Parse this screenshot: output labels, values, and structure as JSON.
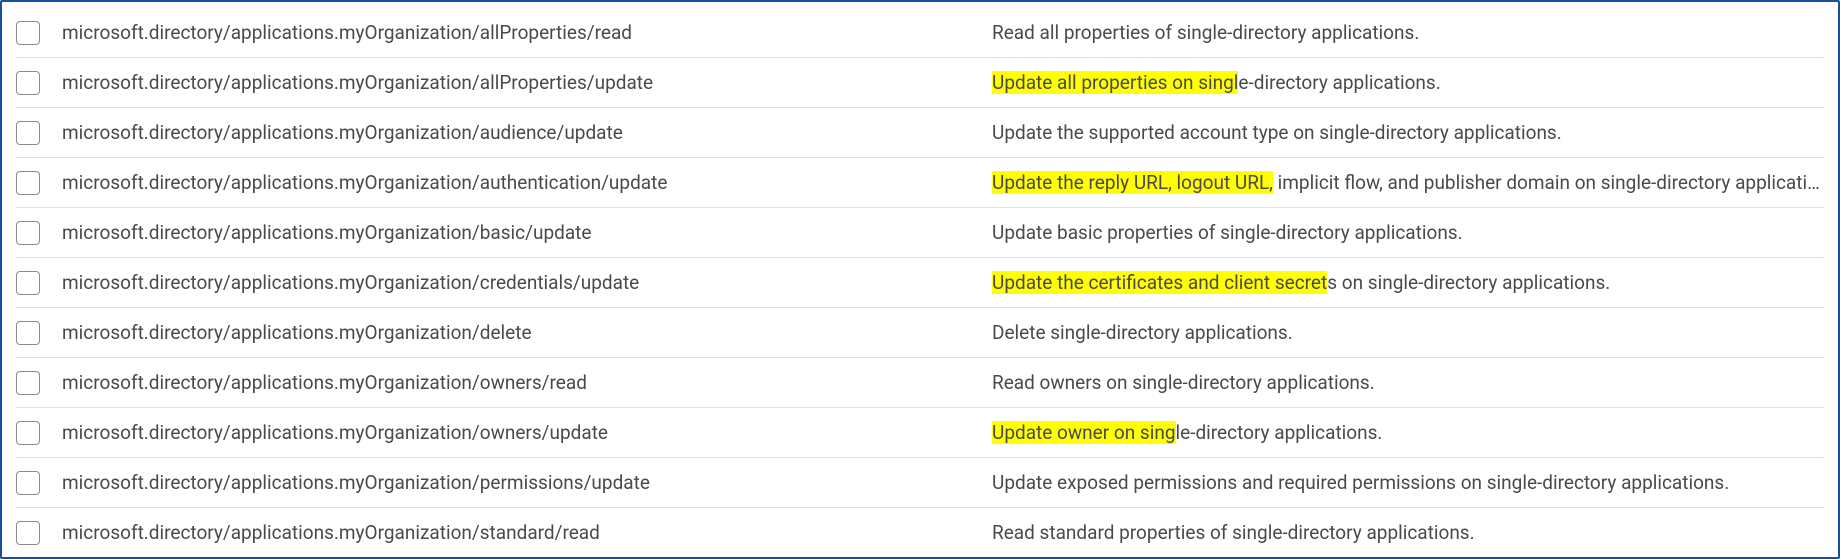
{
  "permissionsTable": {
    "rows": [
      {
        "permission": "microsoft.directory/applications.myOrganization/allProperties/read",
        "description": "Read all properties of single-directory applications.",
        "highlight": null
      },
      {
        "permission": "microsoft.directory/applications.myOrganization/allProperties/update",
        "description": "Update all properties on single-directory applications.",
        "highlight": "Update all properties on singl"
      },
      {
        "permission": "microsoft.directory/applications.myOrganization/audience/update",
        "description": "Update the supported account type on single-directory applications.",
        "highlight": null
      },
      {
        "permission": "microsoft.directory/applications.myOrganization/authentication/update",
        "description": "Update the reply URL, logout URL, implicit flow, and publisher domain on single-directory applications.",
        "highlight": "Update the reply URL, logout URL,"
      },
      {
        "permission": "microsoft.directory/applications.myOrganization/basic/update",
        "description": "Update basic properties of single-directory applications.",
        "highlight": null
      },
      {
        "permission": "microsoft.directory/applications.myOrganization/credentials/update",
        "description": "Update the certificates and client secrets on single-directory applications.",
        "highlight": "Update the certificates and client secret"
      },
      {
        "permission": "microsoft.directory/applications.myOrganization/delete",
        "description": "Delete single-directory applications.",
        "highlight": null
      },
      {
        "permission": "microsoft.directory/applications.myOrganization/owners/read",
        "description": "Read owners on single-directory applications.",
        "highlight": null
      },
      {
        "permission": "microsoft.directory/applications.myOrganization/owners/update",
        "description": "Update owner on single-directory applications.",
        "highlight": "Update owner on sing"
      },
      {
        "permission": "microsoft.directory/applications.myOrganization/permissions/update",
        "description": "Update exposed permissions and required permissions on single-directory applications.",
        "highlight": null
      },
      {
        "permission": "microsoft.directory/applications.myOrganization/standard/read",
        "description": "Read standard properties of single-directory applications.",
        "highlight": null
      }
    ]
  }
}
